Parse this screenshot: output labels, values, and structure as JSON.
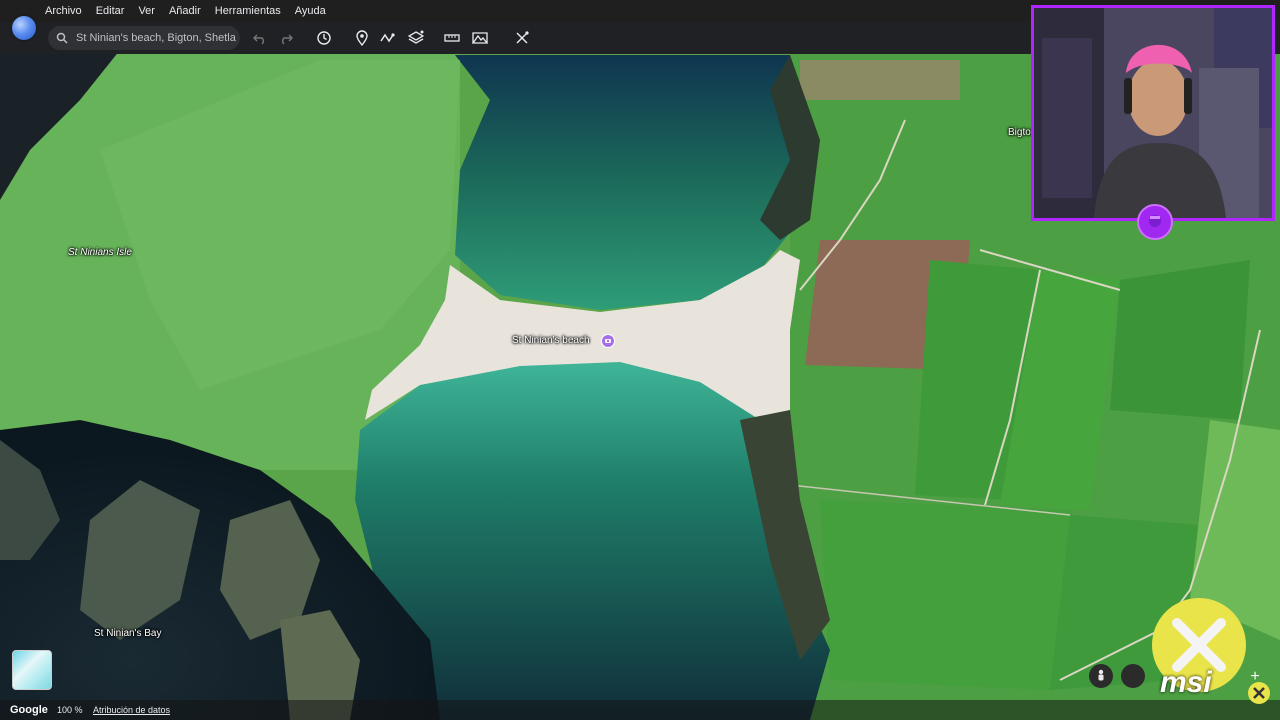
{
  "menu": {
    "items": [
      "Archivo",
      "Editar",
      "Ver",
      "Añadir",
      "Herramientas",
      "Ayuda"
    ]
  },
  "search": {
    "value": "St Ninian's beach, Bigton, Shetla"
  },
  "toolbar": {
    "icons": [
      "undo-icon",
      "redo-icon",
      "history-icon",
      "placemark-icon",
      "path-icon",
      "layers-icon",
      "ruler-icon",
      "image-overlay-icon",
      "satellite-icon"
    ]
  },
  "map": {
    "labels": {
      "isle": "St Ninians Isle",
      "beach": "St Ninian's beach",
      "bay": "St Ninian's Bay",
      "town": "Bigton"
    }
  },
  "webcam": {
    "partial_label": "Bigto"
  },
  "status": {
    "brand": "Google",
    "zoom": "100 %",
    "attribution": "Atribución de datos"
  },
  "sponsor": {
    "brand": "msi"
  },
  "colors": {
    "accent": "#b026ff",
    "pin": "#a56ee8",
    "sponsor": "#e9e44a"
  }
}
